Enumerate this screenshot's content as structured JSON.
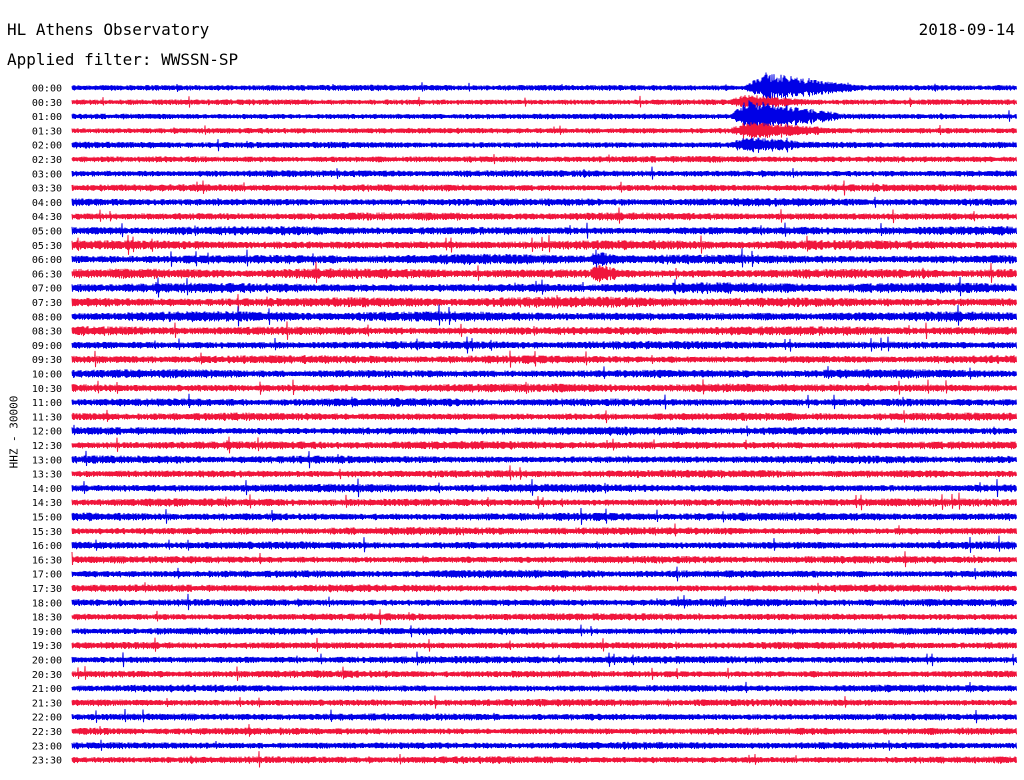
{
  "header": {
    "station": "HL Athens Observatory",
    "filter": "Applied filter: WWSSN-SP",
    "date": "2018-09-14"
  },
  "chart_data": {
    "type": "line",
    "ylabel": "HHZ - 30000",
    "row_labels": [
      "00:00",
      "00:30",
      "01:00",
      "01:30",
      "02:00",
      "02:30",
      "03:00",
      "03:30",
      "04:00",
      "04:30",
      "05:00",
      "05:30",
      "06:00",
      "06:30",
      "07:00",
      "07:30",
      "08:00",
      "08:30",
      "09:00",
      "09:30",
      "10:00",
      "10:30",
      "11:00",
      "11:30",
      "12:00",
      "12:30",
      "13:00",
      "13:30",
      "14:00",
      "14:30",
      "15:00",
      "15:30",
      "16:00",
      "16:30",
      "17:00",
      "17:30",
      "18:00",
      "18:30",
      "19:00",
      "19:30",
      "20:00",
      "20:30",
      "21:00",
      "21:30",
      "22:00",
      "22:30",
      "23:00",
      "23:30"
    ],
    "series_colors": [
      "#0000e6",
      "#f0163c"
    ],
    "noise_level": [
      0.25,
      0.2,
      0.2,
      0.2,
      0.3,
      0.3,
      0.35,
      0.4,
      0.5,
      0.5,
      0.6,
      0.7,
      0.8,
      0.8,
      0.85,
      0.85,
      0.8,
      0.65,
      0.55,
      0.55,
      0.6,
      0.6,
      0.55,
      0.5,
      0.55,
      0.55,
      0.5,
      0.5,
      0.55,
      0.5,
      0.55,
      0.5,
      0.45,
      0.45,
      0.5,
      0.45,
      0.45,
      0.4,
      0.4,
      0.4,
      0.45,
      0.4,
      0.4,
      0.4,
      0.4,
      0.4,
      0.4,
      0.4
    ],
    "events": [
      {
        "row": 0,
        "x_minutes": 21.5,
        "amplitude": 14,
        "duration_minutes": 3.5
      },
      {
        "row": 1,
        "x_minutes": 21.0,
        "amplitude": 6,
        "duration_minutes": 2.5
      },
      {
        "row": 2,
        "x_minutes": 21.0,
        "amplitude": 16,
        "duration_minutes": 3.5
      },
      {
        "row": 3,
        "x_minutes": 21.0,
        "amplitude": 8,
        "duration_minutes": 3.5
      },
      {
        "row": 4,
        "x_minutes": 21.0,
        "amplitude": 6,
        "duration_minutes": 2.5
      },
      {
        "row": 12,
        "x_minutes": 16.5,
        "amplitude": 6,
        "duration_minutes": 1.0
      },
      {
        "row": 13,
        "x_minutes": 16.5,
        "amplitude": 7,
        "duration_minutes": 1.0
      }
    ]
  }
}
